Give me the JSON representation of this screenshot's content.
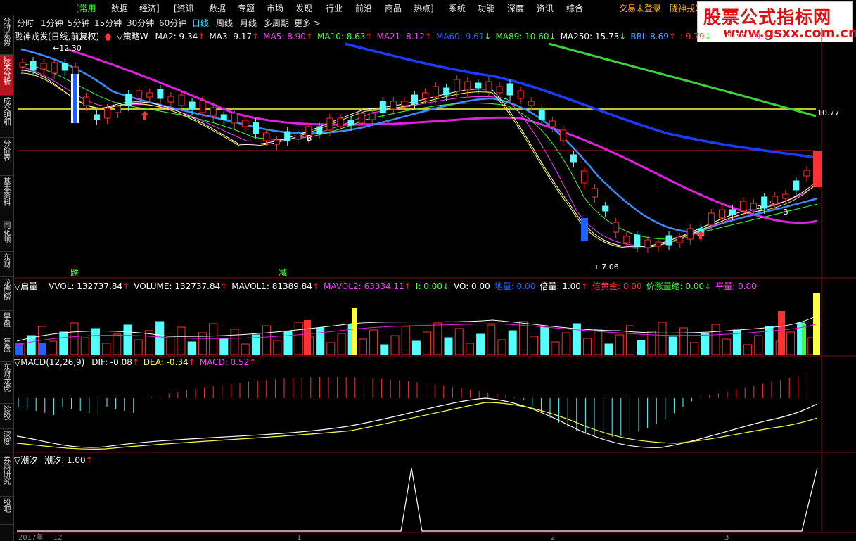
{
  "menu": {
    "items": [
      "[常用",
      "数据",
      "经济]",
      "[资讯",
      "数据",
      "专题",
      "市场",
      "发现",
      "行业",
      "前沿",
      "商品",
      "热点]",
      "系统",
      "功能",
      "深度",
      "资讯",
      "综合"
    ],
    "login_status": "交易未登录",
    "stock_short": "陇神戎发"
  },
  "periods": [
    "分时",
    "1分钟",
    "5分钟",
    "15分钟",
    "30分钟",
    "60分钟",
    "日线",
    "周线",
    "月线",
    "多周期",
    "更多 >"
  ],
  "active_period": "日线",
  "sidebar": [
    "分时走势",
    "技术分析",
    "成交明细",
    "分价表",
    "基本资料",
    "同花顺",
    "东财",
    "龙虎榜",
    "早盘",
    "复盘",
    "东财龙虎",
    "诊股",
    "深度",
    "券商研究",
    "股吧"
  ],
  "active_sidebar": "技术分析",
  "main_indicator": {
    "title": "陇神戎发(日线,前复权)",
    "strategy": "▽策略W",
    "ma": [
      {
        "label": "MA2: 9.34",
        "arrow": "↑",
        "color": "#ffffff"
      },
      {
        "label": "MA3: 9.17",
        "arrow": "↑",
        "color": "#ffffff"
      },
      {
        "label": "MA5: 8.90",
        "arrow": "↑",
        "color": "#ff40ff"
      },
      {
        "label": "MA10: 8.63",
        "arrow": "↑",
        "color": "#40ff40"
      },
      {
        "label": "MA21: 8.12",
        "arrow": "↑",
        "color": "#ff40ff"
      },
      {
        "label": "MA60: 9.61",
        "arrow": "↓",
        "color": "#2060ff"
      },
      {
        "label": "MA89: 10.60",
        "arrow": "↓",
        "color": "#40ff40"
      },
      {
        "label": "MA250: 15.73",
        "arrow": "↓",
        "color": "#ffffff"
      },
      {
        "label": "BBI: 8.69",
        "arrow": "↑",
        "color": "#4a9cff"
      },
      {
        "label": ": 9.79",
        "arrow": "↓",
        "color": "#ff3030"
      },
      {
        "label": ": 10.77",
        "arrow": "",
        "color": "#ffffff"
      },
      {
        "label": ": 9.7",
        "arrow": "",
        "color": "#ff40ff"
      }
    ],
    "price_high": "12.30",
    "price_low": "7.06",
    "ref_line_price": "10.77",
    "marks": {
      "fall": "跌",
      "reduce": "减"
    }
  },
  "volume_indicator": {
    "title": "▽启量_",
    "items": [
      {
        "label": "VVOL: 132737.84",
        "arrow": "↑",
        "color": "#ffffff"
      },
      {
        "label": "VOLUME: 132737.84",
        "arrow": "↑",
        "color": "#ffffff"
      },
      {
        "label": "MAVOL1: 81389.84",
        "arrow": "↑",
        "color": "#ffffff"
      },
      {
        "label": "MAVOL2: 63334.11",
        "arrow": "↑",
        "color": "#ff40ff"
      },
      {
        "label": "I: 0.00",
        "arrow": "↓",
        "color": "#40ff40"
      },
      {
        "label": "VO: 0.00",
        "arrow": "",
        "color": "#ffffff"
      },
      {
        "label": "地量: 0.00",
        "arrow": "",
        "color": "#2060ff"
      },
      {
        "label": "倍量: 1.00",
        "arrow": "↑",
        "color": "#ffffff"
      },
      {
        "label": "倍黄金: 0.00",
        "arrow": "",
        "color": "#ff3030"
      },
      {
        "label": "价涨量缩: 0.00",
        "arrow": "↓",
        "color": "#40ff40"
      },
      {
        "label": "平量: 0.00",
        "arrow": "",
        "color": "#ff40ff"
      }
    ]
  },
  "macd_indicator": {
    "title": "▽MACD(12,26,9)",
    "items": [
      {
        "label": "DIF: -0.08",
        "arrow": "↑",
        "color": "#ffffff"
      },
      {
        "label": "DEA: -0.34",
        "arrow": "↑",
        "color": "#ffff40"
      },
      {
        "label": "MACD: 0.52",
        "arrow": "↑",
        "color": "#ff40ff"
      }
    ]
  },
  "tide_indicator": {
    "title": "▽潮汐",
    "items": [
      {
        "label": "潮汐: 1.00",
        "arrow": "↑",
        "color": "#ffffff"
      }
    ]
  },
  "time_axis": [
    "2017年",
    "12",
    "1",
    "2",
    "3"
  ],
  "watermark": {
    "title": "股票公式指标网",
    "url": "www.gsxx.com.cn"
  },
  "colors": {
    "up": "#ff3030",
    "down": "#54ffff",
    "ma60": "#1a3cff",
    "ma250": "#3cd23c",
    "ma21": "#e020e0",
    "ref_yellow": "#ffff40",
    "ref_red": "#c01030",
    "accent_red": "#b4161b"
  }
}
